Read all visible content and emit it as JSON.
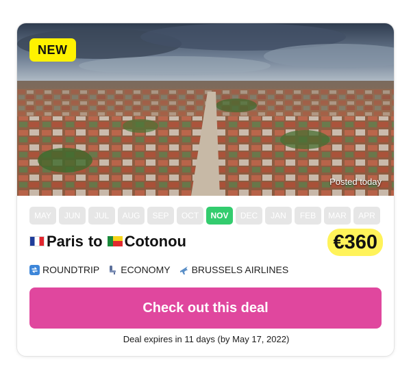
{
  "deal": {
    "badge": "NEW",
    "posted": "Posted today",
    "months": [
      {
        "label": "MAY",
        "active": false
      },
      {
        "label": "JUN",
        "active": false
      },
      {
        "label": "JUL",
        "active": false
      },
      {
        "label": "AUG",
        "active": false
      },
      {
        "label": "SEP",
        "active": false
      },
      {
        "label": "OCT",
        "active": false
      },
      {
        "label": "NOV",
        "active": true
      },
      {
        "label": "DEC",
        "active": false
      },
      {
        "label": "JAN",
        "active": false
      },
      {
        "label": "FEB",
        "active": false
      },
      {
        "label": "MAR",
        "active": false
      },
      {
        "label": "APR",
        "active": false
      }
    ],
    "origin": "Paris",
    "connector": "to",
    "destination": "Cotonou",
    "origin_flag": "france-flag",
    "destination_flag": "benin-flag",
    "price": "€360",
    "trip_type": "ROUNDTRIP",
    "cabin": "ECONOMY",
    "airline": "BRUSSELS AIRLINES",
    "cta": "Check out this deal",
    "expires": "Deal expires in 11 days (by May 17, 2022)"
  },
  "colors": {
    "badge_bg": "#fff200",
    "month_inactive": "#e6e6e6",
    "month_active": "#33cc6e",
    "price_highlight": "#fff35a",
    "cta_bg": "#e0479e"
  },
  "icons": {
    "trip_type": "roundtrip-arrows-icon",
    "cabin": "seat-icon",
    "airline": "airplane-icon"
  }
}
